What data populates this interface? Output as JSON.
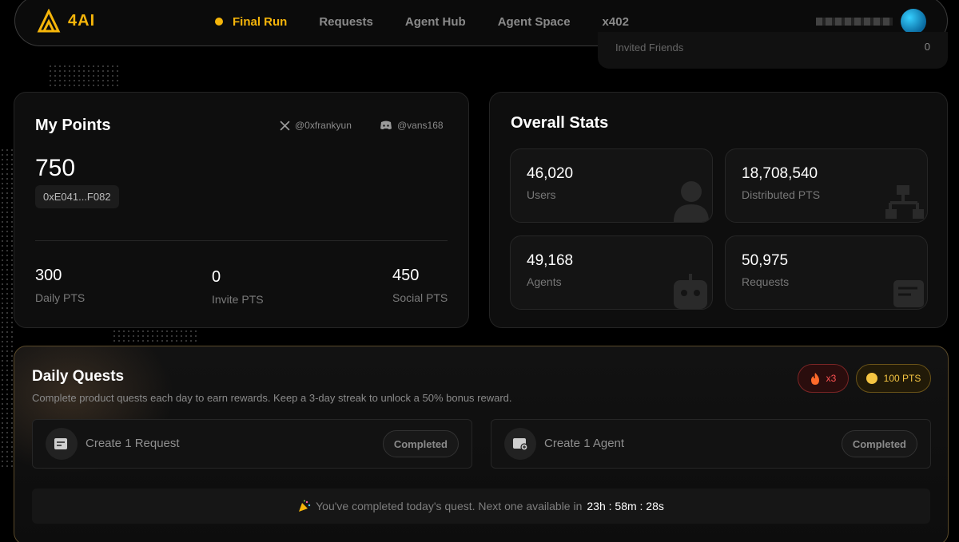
{
  "nav": {
    "logo_text": "4AI",
    "links": [
      {
        "label": "Final Run",
        "active": true
      },
      {
        "label": "Requests"
      },
      {
        "label": "Agent Hub"
      },
      {
        "label": "Agent Space"
      },
      {
        "label": "x402"
      }
    ]
  },
  "partial_card": {
    "label": "Invited Friends",
    "value": "0"
  },
  "my_points": {
    "title": "My Points",
    "twitter_handle": "@0xfrankyun",
    "discord_handle": "@vans168",
    "points": "750",
    "address": "0xE041...F082",
    "stats": [
      {
        "value": "300",
        "label": "Daily PTS"
      },
      {
        "value": "0",
        "label": "Invite PTS"
      },
      {
        "value": "450",
        "label": "Social PTS"
      }
    ]
  },
  "overall_stats": {
    "title": "Overall Stats",
    "tiles": [
      {
        "value": "46,020",
        "label": "Users",
        "icon": "user-icon"
      },
      {
        "value": "18,708,540",
        "label": "Distributed PTS",
        "icon": "distribution-icon"
      },
      {
        "value": "49,168",
        "label": "Agents",
        "icon": "robot-icon"
      },
      {
        "value": "50,975",
        "label": "Requests",
        "icon": "request-icon"
      }
    ]
  },
  "daily_quests": {
    "title": "Daily Quests",
    "description": "Complete product quests each day to earn rewards. Keep a 3-day streak to unlock a 50% bonus reward.",
    "streak": "x3",
    "reward": "100 PTS",
    "quests": [
      {
        "label": "Create 1 Request",
        "status": "Completed"
      },
      {
        "label": "Create 1 Agent",
        "status": "Completed"
      }
    ],
    "banner_text": "You've completed today's quest. Next one available in",
    "countdown": "23h : 58m : 28s"
  },
  "colors": {
    "accent": "#f5b50a",
    "streak": "#ff5252",
    "coin": "#f5c542"
  }
}
